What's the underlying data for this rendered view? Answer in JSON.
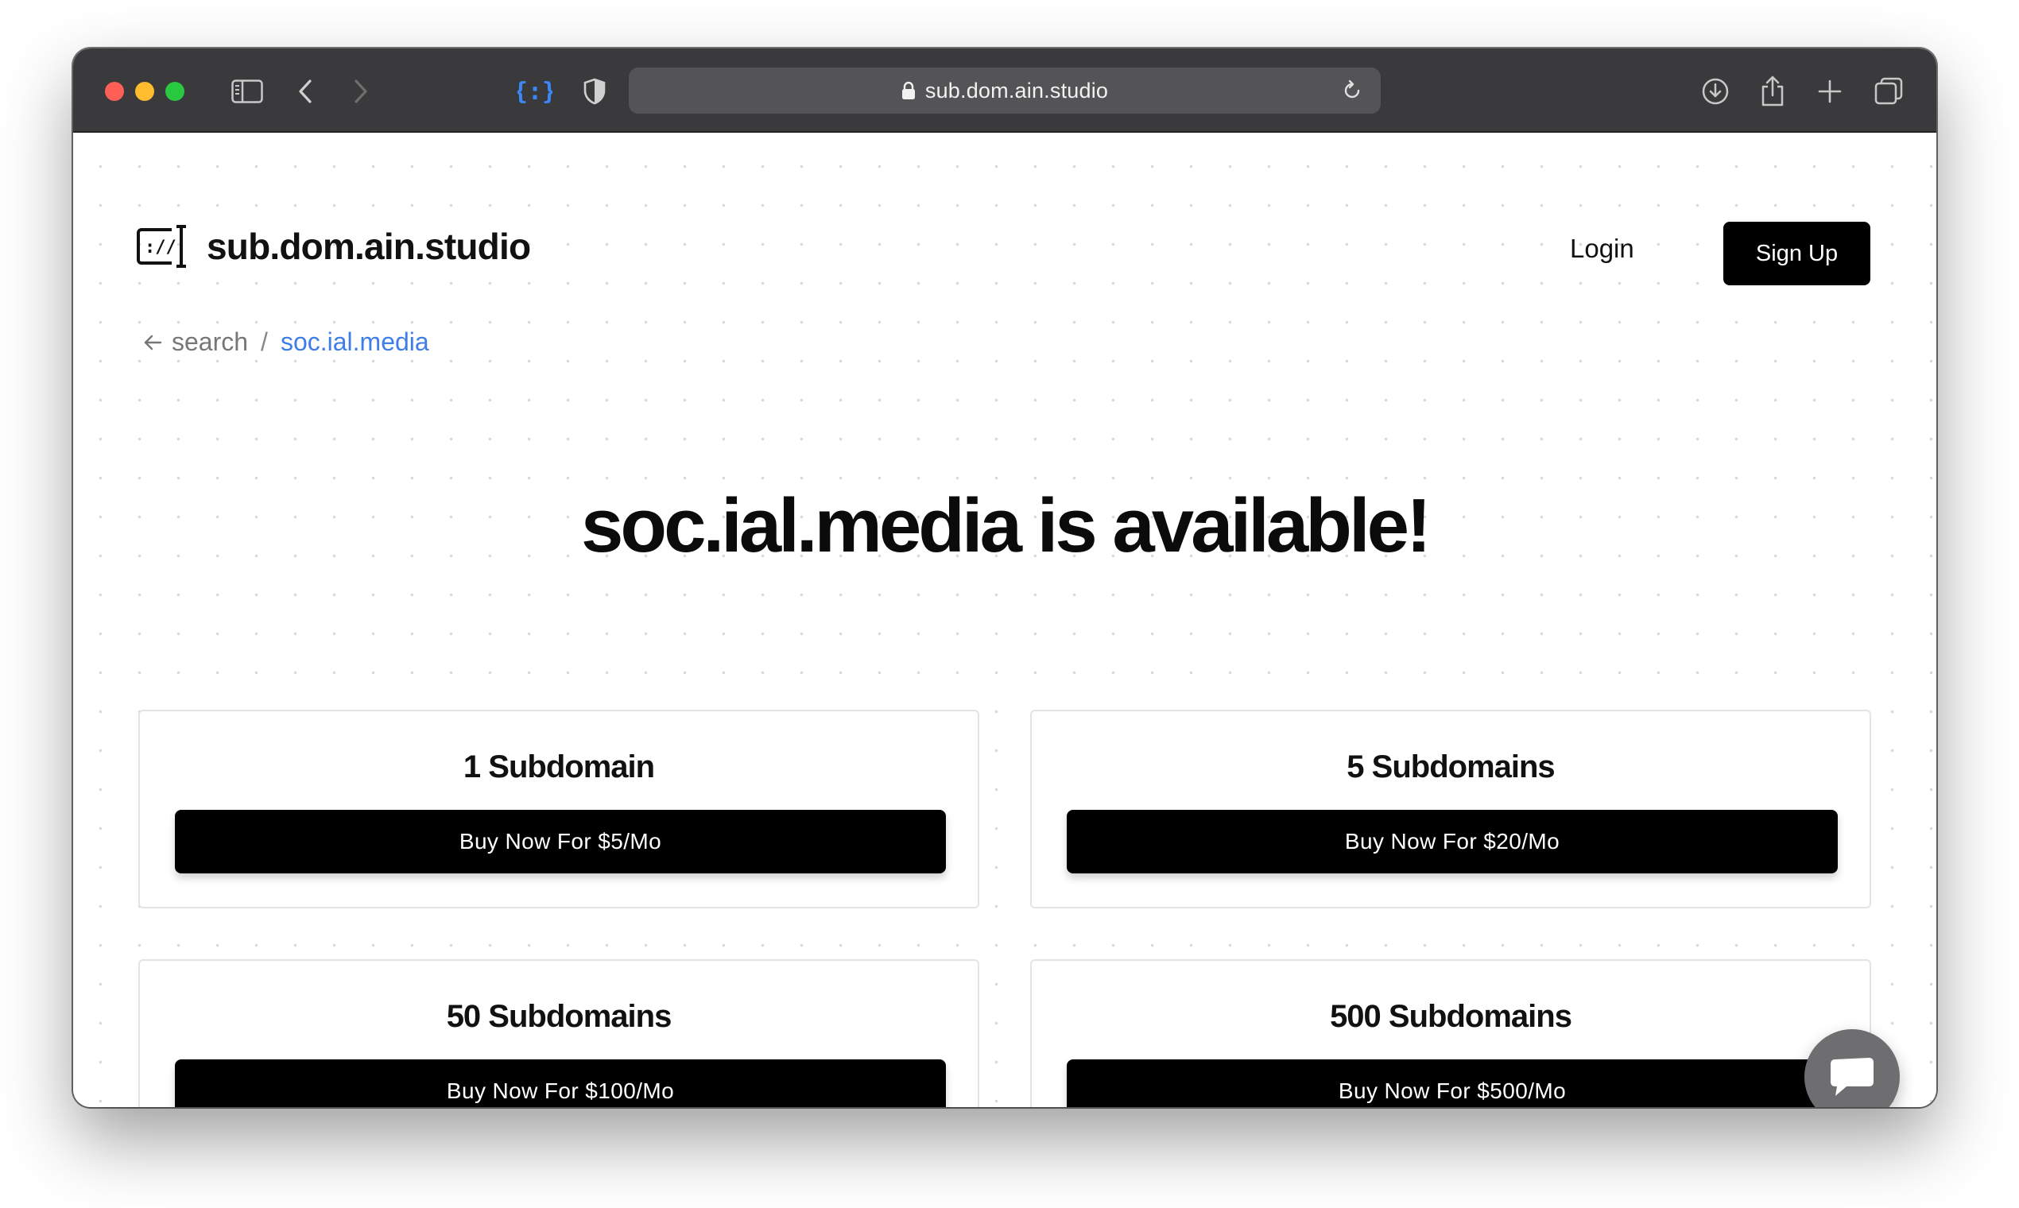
{
  "browser": {
    "url": "sub.dom.ain.studio"
  },
  "header": {
    "brand_name": "sub.dom.ain.studio",
    "login_label": "Login",
    "signup_label": "Sign Up"
  },
  "breadcrumb": {
    "back_label": "search",
    "separator": "/",
    "current": "soc.ial.media"
  },
  "headline": "soc.ial.media is available!",
  "plans": [
    {
      "title": "1 Subdomain",
      "button": "Buy Now For $5/Mo"
    },
    {
      "title": "5 Subdomains",
      "button": "Buy Now For $20/Mo"
    },
    {
      "title": "50 Subdomains",
      "button": "Buy Now For $100/Mo"
    },
    {
      "title": "500 Subdomains",
      "button": "Buy Now For $500/Mo"
    }
  ],
  "colors": {
    "accent_link": "#3f7ee8",
    "primary_button": "#000000",
    "toolbar": "#3a3a3c"
  },
  "icons": {
    "sidebar": "sidebar-icon",
    "back": "chevron-left-icon",
    "forward": "chevron-right-icon",
    "extension": "braces-extension-icon",
    "shield": "shield-icon",
    "lock": "lock-icon",
    "reload": "reload-icon",
    "download": "download-icon",
    "share": "share-icon",
    "new_tab": "plus-icon",
    "tabs": "tabs-overview-icon",
    "chat": "chat-icon"
  }
}
